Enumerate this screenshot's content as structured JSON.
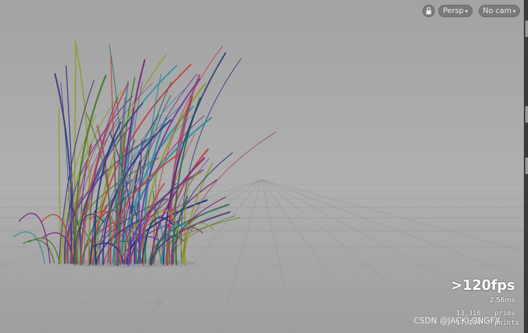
{
  "viewport": {
    "lock_label": "",
    "view_menu": {
      "label": "Persp",
      "caret": "▾"
    },
    "camera_menu": {
      "label": "No cam",
      "caret": "▾"
    }
  },
  "stats": {
    "fps": ">120fps",
    "frame_time": "2.56ms",
    "prims_count": "13,316",
    "prims_label": "prims",
    "points_count": "17,134",
    "points_label": "points"
  },
  "watermark": "CSDN @JACKLONGFX",
  "colors": {
    "grass_blades": [
      "#1e2f78",
      "#7a2a7a",
      "#2f8f9f",
      "#8f9a2a",
      "#3c3c7a",
      "#a03a60",
      "#2c6e4e",
      "#6b3aa0",
      "#4a7a2a",
      "#c04040"
    ]
  }
}
